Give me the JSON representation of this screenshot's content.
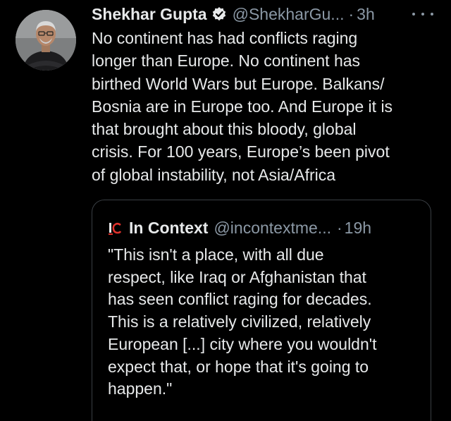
{
  "tweet": {
    "author_name": "Shekhar Gupta",
    "handle": "@ShekharGu...",
    "separator": "·",
    "time": "3h",
    "text": "No continent has had conflicts raging\nlonger than Europe. No continent has\nbirthed World Wars but Europe. Balkans/\nBosnia are in Europe too. And Europe it is\nthat brought about this bloody, global\ncrisis. For 100 years, Europe’s been pivot\nof global instability, not Asia/Africa",
    "avatar_icon": "profile-photo",
    "verified_icon": "verified-badge-icon",
    "more_icon": "more-options-icon"
  },
  "quoted_tweet": {
    "logo_icon": "in-context-logo-icon",
    "author_name": "In Context",
    "handle": "@incontextme...",
    "separator": "·",
    "time": "19h",
    "text": "\"This isn't a place, with all due\nrespect, like Iraq or Afghanistan that\nhas seen conflict raging for decades.\nThis is a relatively civilized, relatively\nEuropean [...] city where you wouldn't\nexpect that, or hope that it's going to\nhappen.\""
  },
  "colors": {
    "background": "#000000",
    "text_primary": "#e7e9ea",
    "text_secondary": "#8b98a5",
    "border": "#3a3f44",
    "logo_red": "#e0322c"
  }
}
